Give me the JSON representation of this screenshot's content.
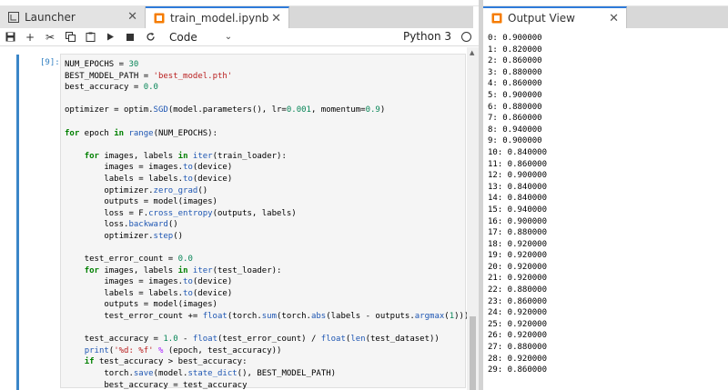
{
  "tabs": [
    {
      "label": "Launcher",
      "icon": "launcher-icon",
      "active": false
    },
    {
      "label": "train_model.ipynb",
      "icon": "notebook-icon",
      "active": true
    }
  ],
  "output_tab": {
    "label": "Output View",
    "icon": "output-view-icon"
  },
  "toolbar": {
    "buttons": [
      "save-icon",
      "add-cell-icon",
      "cut-icon",
      "copy-icon",
      "paste-icon",
      "run-icon",
      "stop-icon",
      "restart-icon"
    ],
    "cell_type": "Code",
    "kernel": "Python 3"
  },
  "cell": {
    "prompt": "[9]:",
    "lines": [
      [
        {
          "t": "NUM_EPOCHS = "
        },
        {
          "t": "30",
          "c": "num"
        }
      ],
      [
        {
          "t": "BEST_MODEL_PATH = "
        },
        {
          "t": "'best_model.pth'",
          "c": "str"
        }
      ],
      [
        {
          "t": "best_accuracy = "
        },
        {
          "t": "0.0",
          "c": "num"
        }
      ],
      [
        {
          "t": ""
        }
      ],
      [
        {
          "t": "optimizer = optim."
        },
        {
          "t": "SGD",
          "c": "fn"
        },
        {
          "t": "(model.parameters(), lr="
        },
        {
          "t": "0.001",
          "c": "num"
        },
        {
          "t": ", momentum="
        },
        {
          "t": "0.9",
          "c": "num"
        },
        {
          "t": ")"
        }
      ],
      [
        {
          "t": ""
        }
      ],
      [
        {
          "t": "for",
          "c": "kw"
        },
        {
          "t": " epoch "
        },
        {
          "t": "in",
          "c": "kw"
        },
        {
          "t": " "
        },
        {
          "t": "range",
          "c": "fn"
        },
        {
          "t": "(NUM_EPOCHS):"
        }
      ],
      [
        {
          "t": ""
        }
      ],
      [
        {
          "t": "    "
        },
        {
          "t": "for",
          "c": "kw"
        },
        {
          "t": " images, labels "
        },
        {
          "t": "in",
          "c": "kw"
        },
        {
          "t": " "
        },
        {
          "t": "iter",
          "c": "fn"
        },
        {
          "t": "(train_loader):"
        }
      ],
      [
        {
          "t": "        images = images."
        },
        {
          "t": "to",
          "c": "fn"
        },
        {
          "t": "(device)"
        }
      ],
      [
        {
          "t": "        labels = labels."
        },
        {
          "t": "to",
          "c": "fn"
        },
        {
          "t": "(device)"
        }
      ],
      [
        {
          "t": "        optimizer."
        },
        {
          "t": "zero_grad",
          "c": "fn"
        },
        {
          "t": "()"
        }
      ],
      [
        {
          "t": "        outputs = model(images)"
        }
      ],
      [
        {
          "t": "        loss = F."
        },
        {
          "t": "cross_entropy",
          "c": "fn"
        },
        {
          "t": "(outputs, labels)"
        }
      ],
      [
        {
          "t": "        loss."
        },
        {
          "t": "backward",
          "c": "fn"
        },
        {
          "t": "()"
        }
      ],
      [
        {
          "t": "        optimizer."
        },
        {
          "t": "step",
          "c": "fn"
        },
        {
          "t": "()"
        }
      ],
      [
        {
          "t": ""
        }
      ],
      [
        {
          "t": "    test_error_count = "
        },
        {
          "t": "0.0",
          "c": "num"
        }
      ],
      [
        {
          "t": "    "
        },
        {
          "t": "for",
          "c": "kw"
        },
        {
          "t": " images, labels "
        },
        {
          "t": "in",
          "c": "kw"
        },
        {
          "t": " "
        },
        {
          "t": "iter",
          "c": "fn"
        },
        {
          "t": "(test_loader):"
        }
      ],
      [
        {
          "t": "        images = images."
        },
        {
          "t": "to",
          "c": "fn"
        },
        {
          "t": "(device)"
        }
      ],
      [
        {
          "t": "        labels = labels."
        },
        {
          "t": "to",
          "c": "fn"
        },
        {
          "t": "(device)"
        }
      ],
      [
        {
          "t": "        outputs = model(images)"
        }
      ],
      [
        {
          "t": "        test_error_count += "
        },
        {
          "t": "float",
          "c": "fn"
        },
        {
          "t": "(torch."
        },
        {
          "t": "sum",
          "c": "fn"
        },
        {
          "t": "(torch."
        },
        {
          "t": "abs",
          "c": "fn"
        },
        {
          "t": "(labels - outputs."
        },
        {
          "t": "argmax",
          "c": "fn"
        },
        {
          "t": "("
        },
        {
          "t": "1",
          "c": "num"
        },
        {
          "t": "))))"
        }
      ],
      [
        {
          "t": ""
        }
      ],
      [
        {
          "t": "    test_accuracy = "
        },
        {
          "t": "1.0",
          "c": "num"
        },
        {
          "t": " - "
        },
        {
          "t": "float",
          "c": "fn"
        },
        {
          "t": "(test_error_count) / "
        },
        {
          "t": "float",
          "c": "fn"
        },
        {
          "t": "("
        },
        {
          "t": "len",
          "c": "fn"
        },
        {
          "t": "(test_dataset))"
        }
      ],
      [
        {
          "t": "    "
        },
        {
          "t": "print",
          "c": "fn"
        },
        {
          "t": "("
        },
        {
          "t": "'%d: %f'",
          "c": "str"
        },
        {
          "t": " "
        },
        {
          "t": "%",
          "c": "op"
        },
        {
          "t": " (epoch, test_accuracy))"
        }
      ],
      [
        {
          "t": "    "
        },
        {
          "t": "if",
          "c": "kw"
        },
        {
          "t": " test_accuracy > best_accuracy:"
        }
      ],
      [
        {
          "t": "        torch."
        },
        {
          "t": "save",
          "c": "fn"
        },
        {
          "t": "(model."
        },
        {
          "t": "state_dict",
          "c": "fn"
        },
        {
          "t": "(), BEST_MODEL_PATH)"
        }
      ],
      [
        {
          "t": "        best_accuracy = test_accuracy"
        }
      ]
    ]
  },
  "output": [
    "0: 0.900000",
    "1: 0.820000",
    "2: 0.860000",
    "3: 0.880000",
    "4: 0.860000",
    "5: 0.900000",
    "6: 0.880000",
    "7: 0.860000",
    "8: 0.940000",
    "9: 0.900000",
    "10: 0.840000",
    "11: 0.860000",
    "12: 0.900000",
    "13: 0.840000",
    "14: 0.840000",
    "15: 0.940000",
    "16: 0.900000",
    "17: 0.880000",
    "18: 0.920000",
    "19: 0.920000",
    "20: 0.920000",
    "21: 0.920000",
    "22: 0.880000",
    "23: 0.860000",
    "24: 0.920000",
    "25: 0.920000",
    "26: 0.920000",
    "27: 0.880000",
    "28: 0.920000",
    "29: 0.860000"
  ]
}
